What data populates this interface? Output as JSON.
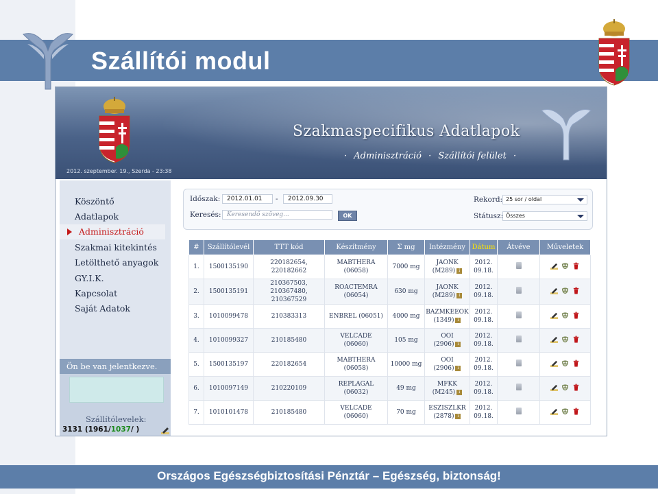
{
  "slide": {
    "title": "Szállítói modul",
    "footer": "Országos Egészségbiztosítási Pénztár – Egészség, biztonság!"
  },
  "app": {
    "header_title": "Szakmaspecifikus Adatlapok",
    "nav_sep": "·",
    "nav_links": [
      "Adminisztráció",
      "Szállítói felület"
    ],
    "date_line": "2012. szeptember. 19., Szerda - 23:38"
  },
  "sidebar": {
    "items": [
      {
        "label": "Köszöntő"
      },
      {
        "label": "Adatlapok"
      },
      {
        "label": "Adminisztráció",
        "active": true
      },
      {
        "label": "Szakmai kitekintés"
      },
      {
        "label": "Letölthető anyagok"
      },
      {
        "label": "GY.I.K."
      },
      {
        "label": "Kapcsolat"
      },
      {
        "label": "Saját Adatok"
      }
    ],
    "login_title": "Ön be van jelentkezve.",
    "waybills_label": "Szállítólevelek:",
    "waybills_total": "3131 (1961/",
    "waybills_green": "1037",
    "waybills_tail": "/      )"
  },
  "filters": {
    "period_label": "Időszak:",
    "period_from": "2012.01.01",
    "period_dash": "-",
    "period_to": "2012.09.30",
    "search_label": "Keresés:",
    "search_placeholder": "Keresendő szöveg...",
    "ok_label": "OK",
    "record_label": "Rekord:",
    "record_value": "25 sor / oldal",
    "status_label": "Státusz:",
    "status_value": "Összes"
  },
  "table": {
    "headers": [
      "#",
      "Szállítólevél",
      "TTT kód",
      "Készítmény",
      "Σ mg",
      "Intézmény",
      "Dátum",
      "Átvéve",
      "Műveletek"
    ],
    "rows": [
      {
        "n": "1.",
        "waybill": "1500135190",
        "ttt": [
          "220182654,",
          "220182662"
        ],
        "product": [
          "MABTHERA",
          "(06058)"
        ],
        "mg": "7000 mg",
        "inst": [
          "JAONK",
          "(M289)"
        ],
        "date": [
          "2012.",
          "09.18."
        ]
      },
      {
        "n": "2.",
        "waybill": "1500135191",
        "ttt": [
          "210367503,",
          "210367480,",
          "210367529"
        ],
        "product": [
          "ROACTEMRA",
          "(06054)"
        ],
        "mg": "630 mg",
        "inst": [
          "JAONK",
          "(M289)"
        ],
        "date": [
          "2012.",
          "09.18."
        ]
      },
      {
        "n": "3.",
        "waybill": "1010099478",
        "ttt": [
          "210383313"
        ],
        "product": [
          "ENBREL (06051)"
        ],
        "mg": "4000 mg",
        "inst": [
          "BAZMKEEOK",
          "(1349)"
        ],
        "date": [
          "2012.",
          "09.18."
        ]
      },
      {
        "n": "4.",
        "waybill": "1010099327",
        "ttt": [
          "210185480"
        ],
        "product": [
          "VELCADE",
          "(06060)"
        ],
        "mg": "105 mg",
        "inst": [
          "OOI",
          "(2906)"
        ],
        "date": [
          "2012.",
          "09.18."
        ]
      },
      {
        "n": "5.",
        "waybill": "1500135197",
        "ttt": [
          "220182654"
        ],
        "product": [
          "MABTHERA",
          "(06058)"
        ],
        "mg": "10000 mg",
        "inst": [
          "OOI",
          "(2906)"
        ],
        "date": [
          "2012.",
          "09.18."
        ]
      },
      {
        "n": "6.",
        "waybill": "1010097149",
        "ttt": [
          "210220109"
        ],
        "product": [
          "REPLAGAL",
          "(06032)"
        ],
        "mg": "49 mg",
        "inst": [
          "MFKK",
          "(M245)"
        ],
        "date": [
          "2012.",
          "09.18."
        ]
      },
      {
        "n": "7.",
        "waybill": "1010101478",
        "ttt": [
          "210185480"
        ],
        "product": [
          "VELCADE",
          "(06060)"
        ],
        "mg": "70 mg",
        "inst": [
          "ESZISZLKR",
          "(2878)"
        ],
        "date": [
          "2012.",
          "09.18."
        ]
      }
    ],
    "info_mark": "i"
  },
  "icons": {
    "edit": "pencil-icon",
    "view": "mask-icon",
    "delete": "trash-icon",
    "received": "document-icon"
  },
  "colors": {
    "band": "#5c7ea9",
    "table_header": "#7990b2",
    "date_header_text": "#ffe600",
    "delete_red": "#c0161a"
  }
}
